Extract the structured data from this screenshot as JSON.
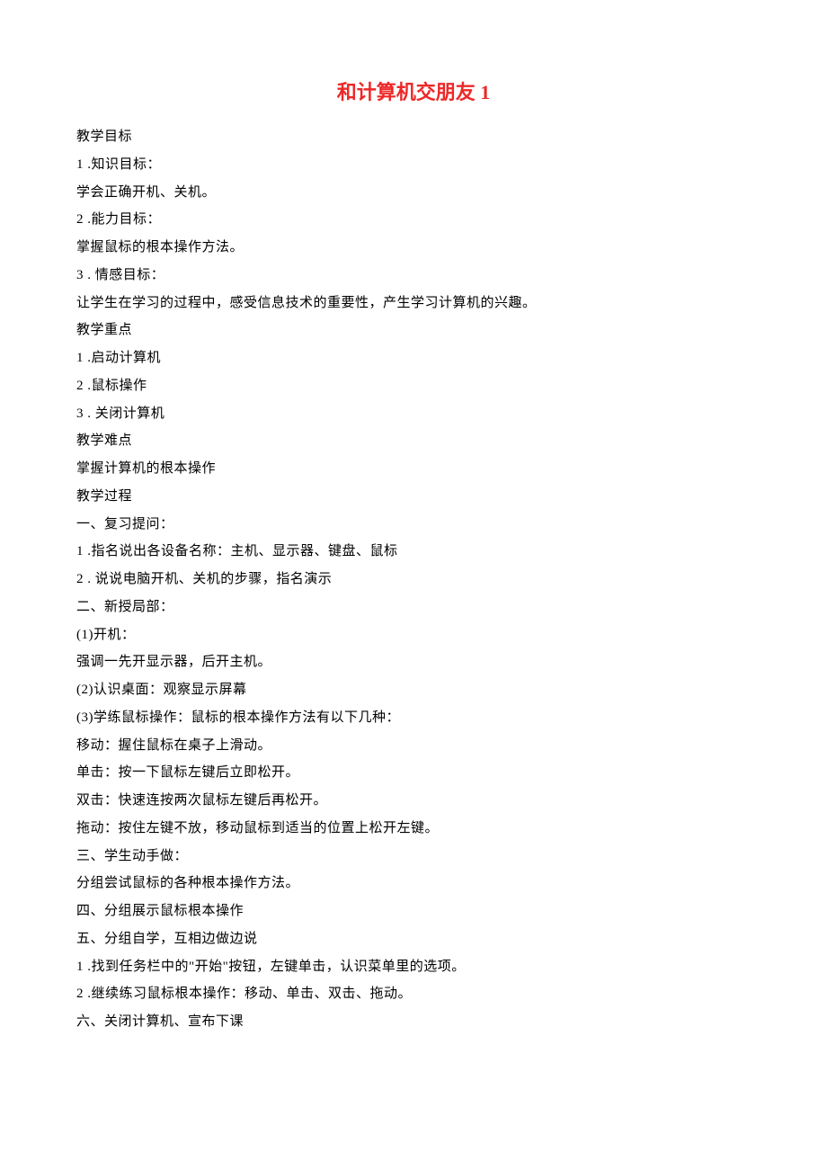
{
  "title": "和计算机交朋友 1",
  "lines": [
    "教学目标",
    "1 .知识目标：",
    "学会正确开机、关机。",
    "2 .能力目标：",
    "掌握鼠标的根本操作方法。",
    "3 . 情感目标：",
    "让学生在学习的过程中，感受信息技术的重要性，产生学习计算机的兴趣。",
    "教学重点",
    "1 .启动计算机",
    "2 .鼠标操作",
    "3 . 关闭计算机",
    "教学难点",
    "掌握计算机的根本操作",
    "教学过程",
    "一、复习提问：",
    "1 .指名说出各设备名称：主机、显示器、键盘、鼠标",
    "2 . 说说电脑开机、关机的步骤，指名演示",
    "二、新授局部：",
    "(1)开机：",
    "强调一先开显示器，后开主机。",
    "(2)认识桌面：观察显示屏幕",
    "(3)学练鼠标操作：鼠标的根本操作方法有以下几种：",
    "移动：握住鼠标在桌子上滑动。",
    "单击：按一下鼠标左键后立即松开。",
    "双击：快速连按两次鼠标左键后再松开。",
    "拖动：按住左键不放，移动鼠标到适当的位置上松开左键。",
    "三、学生动手做：",
    "分组尝试鼠标的各种根本操作方法。",
    "四、分组展示鼠标根本操作",
    "五、分组自学，互相边做边说",
    "1 .找到任务栏中的\"开始\"按钮，左键单击，认识菜单里的选项。",
    "2 .继续练习鼠标根本操作：移动、单击、双击、拖动。",
    "六、关闭计算机、宣布下课"
  ]
}
